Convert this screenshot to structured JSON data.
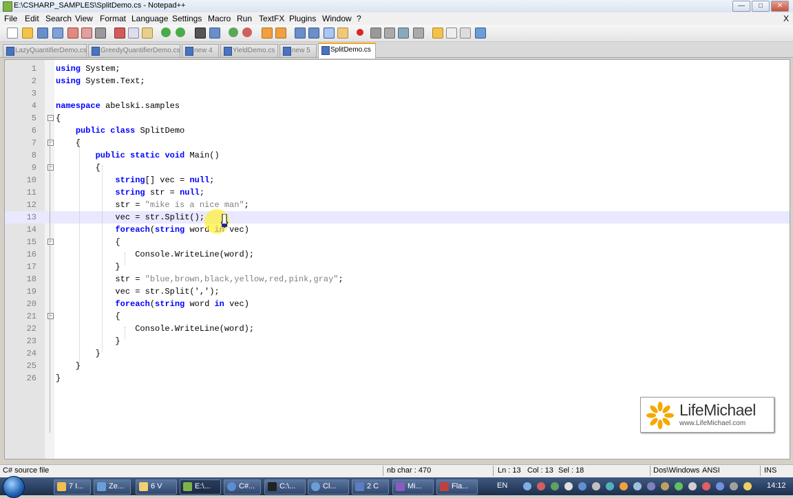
{
  "window": {
    "title": "E:\\CSHARP_SAMPLES\\SplitDemo.cs - Notepad++",
    "min": "—",
    "max": "□",
    "close": "✕"
  },
  "menu": [
    "File",
    "Edit",
    "Search",
    "View",
    "Format",
    "Language",
    "Settings",
    "Macro",
    "Run",
    "TextFX",
    "Plugins",
    "Window",
    "?"
  ],
  "menu_close": "X",
  "tabs": [
    {
      "label": "LazyQuantifierDemo.cs",
      "active": false
    },
    {
      "label": "GreedyQuantifierDemo.cs",
      "active": false
    },
    {
      "label": "new 4",
      "active": false
    },
    {
      "label": "YieldDemo.cs",
      "active": false
    },
    {
      "label": "new 5",
      "active": false
    },
    {
      "label": "SplitDemo.cs",
      "active": true
    }
  ],
  "code_lines": [
    "using System;",
    "using System.Text;",
    "",
    "namespace abelski.samples",
    "{",
    "    public class SplitDemo",
    "    {",
    "        public static void Main()",
    "        {",
    "            string[] vec = null;",
    "            string str = null;",
    "            str = \"mike is a nice man\";",
    "            vec = str.Split();",
    "            foreach(string word in vec)",
    "            {",
    "                Console.WriteLine(word);",
    "            }",
    "            str = \"blue,brown,black,yellow,red,pink,gray\";",
    "            vec = str.Split(',');",
    "            foreach(string word in vec)",
    "            {",
    "                Console.WriteLine(word);",
    "            }",
    "        }",
    "    }",
    "}"
  ],
  "current_line": 13,
  "logo": {
    "name": "LifeMichael",
    "url": "www.LifeMichael.com"
  },
  "status": {
    "file_type": "C# source file",
    "nb_char": "nb char : 470",
    "ln": "Ln : 13",
    "col": "Col : 13",
    "sel": "Sel : 18",
    "eol": "Dos\\Windows",
    "encoding": "ANSI",
    "mode": "INS"
  },
  "taskbar": {
    "buttons": [
      "7 I...",
      "Ze...",
      "6 V",
      "E:\\...",
      "C#...",
      "C:\\...",
      "Cl...",
      "2 C",
      "Mi...",
      "Fla..."
    ],
    "lang": "EN",
    "time": "14:12"
  },
  "colors": {
    "keyword": "#0000ff",
    "string": "#808080",
    "current_line": "#e8e8ff"
  }
}
